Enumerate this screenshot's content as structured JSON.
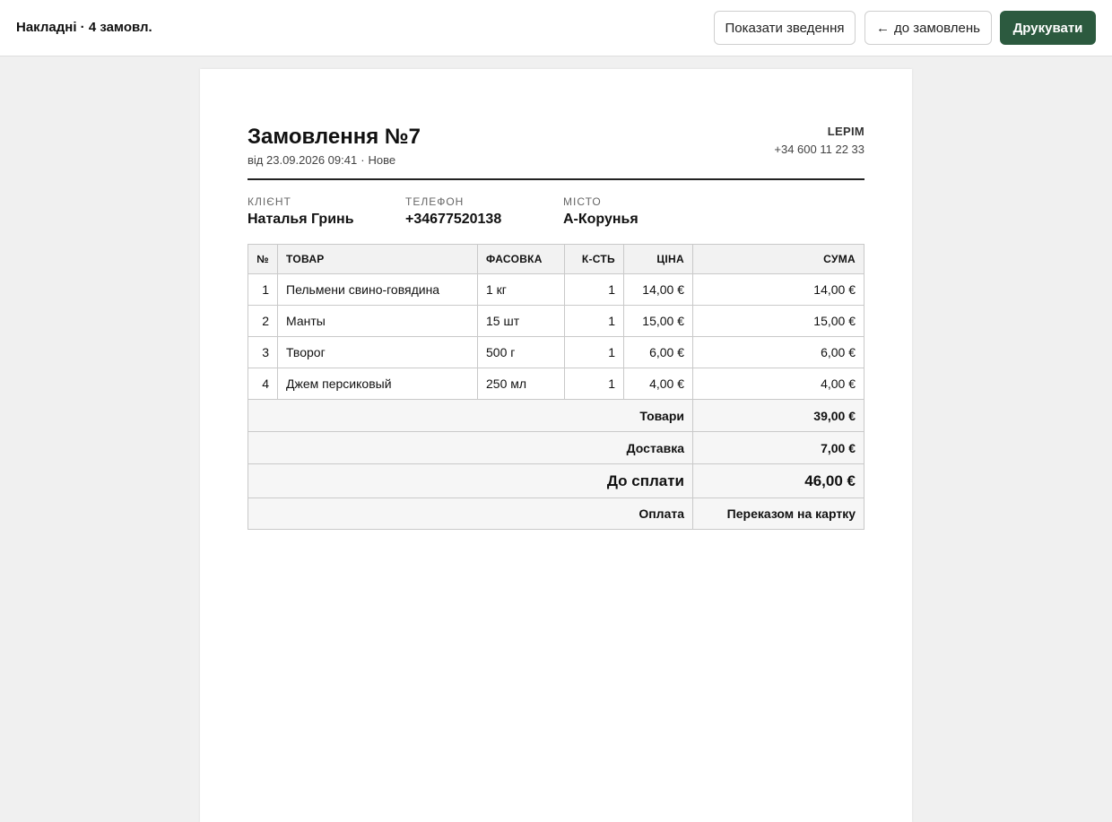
{
  "header": {
    "title": "Накладні · 4 замовл.",
    "summary_label": "Показати зведення",
    "back_arrow": "←",
    "back_label": "до замовлень",
    "print_label": "Друкувати"
  },
  "invoice": {
    "title": "Замовлення №7",
    "date": "від 23.09.2026 09:41",
    "separator": "·",
    "status": "Нове",
    "shop_name": "LEPIM",
    "shop_phone": "+34 600 11 22 33",
    "client_label": "Клієнт",
    "client": "Наталья Гринь",
    "phone_label": "Телефон",
    "phone": "+34677520138",
    "city_label": "Місто",
    "city": "А-Корунья",
    "columns": [
      "№",
      "Товар",
      "Фасовка",
      "К-сть",
      "Ціна",
      "Сума"
    ],
    "rows": [
      {
        "n": "1",
        "name": "Пельмени свино-говядина",
        "pack": "1 кг",
        "qty": "1",
        "price": "14,00 €",
        "sum": "14,00 €"
      },
      {
        "n": "2",
        "name": "Манты",
        "pack": "15 шт",
        "qty": "1",
        "price": "15,00 €",
        "sum": "15,00 €"
      },
      {
        "n": "3",
        "name": "Творог",
        "pack": "500 г",
        "qty": "1",
        "price": "6,00 €",
        "sum": "6,00 €"
      },
      {
        "n": "4",
        "name": "Джем персиковый",
        "pack": "250 мл",
        "qty": "1",
        "price": "4,00 €",
        "sum": "4,00 €"
      }
    ],
    "goods_label": "Товари",
    "goods_total": "39,00 €",
    "delivery_label": "Доставка",
    "delivery_total": "7,00 €",
    "due_label": "До сплати",
    "due_total": "46,00 €",
    "payment_label": "Оплата",
    "payment_method": "Переказом на картку"
  }
}
